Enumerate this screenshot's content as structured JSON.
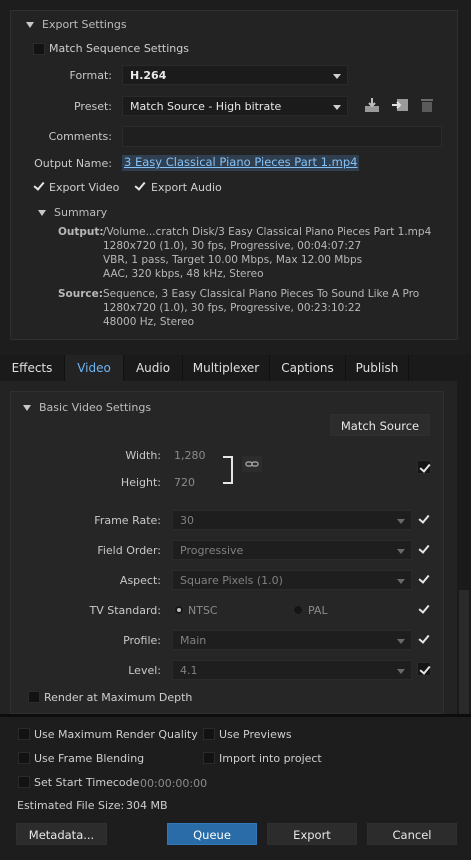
{
  "export_settings": {
    "header": "Export Settings",
    "match_sequence_label": "Match Sequence Settings",
    "format_label": "Format:",
    "format_value": "H.264",
    "preset_label": "Preset:",
    "preset_value": "Match Source - High bitrate",
    "comments_label": "Comments:",
    "comments_value": "",
    "output_name_label": "Output Name:",
    "output_name_value": "3 Easy Classical Piano Pieces Part 1.mp4",
    "export_video_label": "Export Video",
    "export_audio_label": "Export Audio",
    "summary": {
      "header": "Summary",
      "output_label": "Output:",
      "output_lines": [
        "/Volume...cratch Disk/3 Easy Classical Piano Pieces Part 1.mp4",
        "1280x720 (1.0), 30 fps, Progressive, 00:04:07:27",
        "VBR, 1 pass, Target 10.00 Mbps, Max 12.00 Mbps",
        "AAC, 320 kbps, 48 kHz, Stereo"
      ],
      "source_label": "Source:",
      "source_lines": [
        "Sequence, 3 Easy Classical Piano Pieces To Sound Like A Pro",
        "1280x720 (1.0), 30 fps, Progressive, 00:23:10:22",
        "48000 Hz, Stereo"
      ]
    }
  },
  "tabs": [
    {
      "label": "Effects",
      "active": false
    },
    {
      "label": "Video",
      "active": true
    },
    {
      "label": "Audio",
      "active": false
    },
    {
      "label": "Multiplexer",
      "active": false
    },
    {
      "label": "Captions",
      "active": false
    },
    {
      "label": "Publish",
      "active": false
    }
  ],
  "basic_video": {
    "header": "Basic Video Settings",
    "match_source_button": "Match Source",
    "width_label": "Width:",
    "width_value": "1,280",
    "height_label": "Height:",
    "height_value": "720",
    "frame_rate_label": "Frame Rate:",
    "frame_rate_value": "30",
    "field_order_label": "Field Order:",
    "field_order_value": "Progressive",
    "aspect_label": "Aspect:",
    "aspect_value": "Square Pixels (1.0)",
    "tv_standard_label": "TV Standard:",
    "ntsc_label": "NTSC",
    "pal_label": "PAL",
    "profile_label": "Profile:",
    "profile_value": "Main",
    "level_label": "Level:",
    "level_value": "4.1",
    "render_max_depth_label": "Render at Maximum Depth"
  },
  "bottom": {
    "max_render_quality_label": "Use Maximum Render Quality",
    "use_previews_label": "Use Previews",
    "frame_blending_label": "Use Frame Blending",
    "import_into_project_label": "Import into project",
    "set_start_timecode_label": "Set Start Timecode",
    "start_timecode_value": "00:00:00:00",
    "estimated_size_label": "Estimated File Size:",
    "estimated_size_value": "304 MB",
    "metadata_button": "Metadata...",
    "queue_button": "Queue",
    "export_button": "Export",
    "cancel_button": "Cancel"
  },
  "colors": {
    "background": "#1d1d1d",
    "panel": "#232323",
    "accent_blue": "#6fb4f2",
    "queue_button": "#2a6ca8"
  }
}
